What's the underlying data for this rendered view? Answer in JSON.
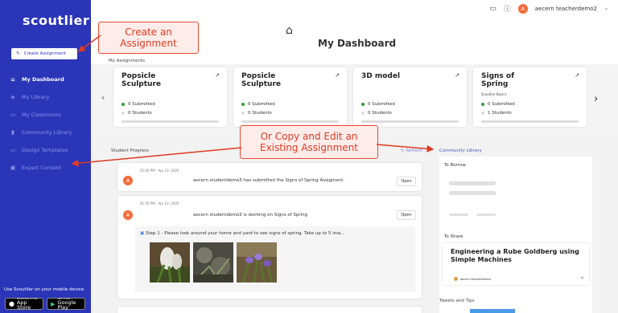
{
  "sidebar": {
    "logo": "scoutlier",
    "create_button": "Create Assignment",
    "nav": [
      {
        "label": "My Dashboard",
        "icon": "home-icon",
        "active": true
      },
      {
        "label": "My Library",
        "icon": "library-icon",
        "active": false
      },
      {
        "label": "My Classrooms",
        "icon": "monitor-icon",
        "active": false
      },
      {
        "label": "Community Library",
        "icon": "community-icon",
        "active": false
      },
      {
        "label": "Design Templates",
        "icon": "template-icon",
        "active": false
      },
      {
        "label": "Expert Content",
        "icon": "expert-icon",
        "active": false
      }
    ],
    "mobile_text": "Use Scoutlier on your mobile device.",
    "app_store": {
      "small": "Download on the",
      "large": "App Store"
    },
    "google_play": {
      "small": "GET IT ON",
      "large": "Google Play"
    }
  },
  "topbar": {
    "avatar_letter": "A",
    "user_name": "aecern teacherdemo2"
  },
  "dashboard": {
    "title": "My Dashboard",
    "my_assignments_label": "My Assignments",
    "cards": [
      {
        "title": "Popsicle Sculpture",
        "subtitle": "",
        "submitted": "0 Submitted",
        "students": "0 Students"
      },
      {
        "title": "Popsicle Sculpture",
        "subtitle": "",
        "submitted": "0 Submitted",
        "students": "0 Students"
      },
      {
        "title": "3D model",
        "subtitle": "",
        "submitted": "0 Submitted",
        "students": "0 Students"
      },
      {
        "title": "Signs of Spring",
        "subtitle": "Scoutlier Basics",
        "submitted": "0 Submitted",
        "students": "1 Students"
      }
    ]
  },
  "progress": {
    "label": "Student Progress",
    "refresh": "Refresh",
    "events": [
      {
        "time": "02:00 PM · Apr 22, 2020",
        "avatar": "A",
        "message": "aecern studentdemo3 has submitted the Signs of Spring Assigment.",
        "open": "Open"
      },
      {
        "time": "01:59 PM · Apr 22, 2020",
        "avatar": "A",
        "message": "aecern studentdemo3 is working on Signs of Spring",
        "open": "Open",
        "step": "Step 1 - Please look around your home and yard to see signs of spring. Take up to 5 ima..."
      }
    ]
  },
  "community": {
    "label": "Community Library",
    "to_borrow": "To Borrow",
    "to_share": "To Share",
    "share_title": "Engineering a Rube Goldberg using Simple Machines",
    "share_author": "aecern teacherdemo2"
  },
  "tweets_label": "Tweets and Tips",
  "callouts": {
    "create": "Create an Assignment",
    "copy": "Or Copy and Edit an Existing Assignment"
  },
  "colors": {
    "sidebar": "#2b35b8",
    "accent_orange": "#f26b3a",
    "callout_red": "#e03a20",
    "submitted_green": "#2e9e3a"
  }
}
